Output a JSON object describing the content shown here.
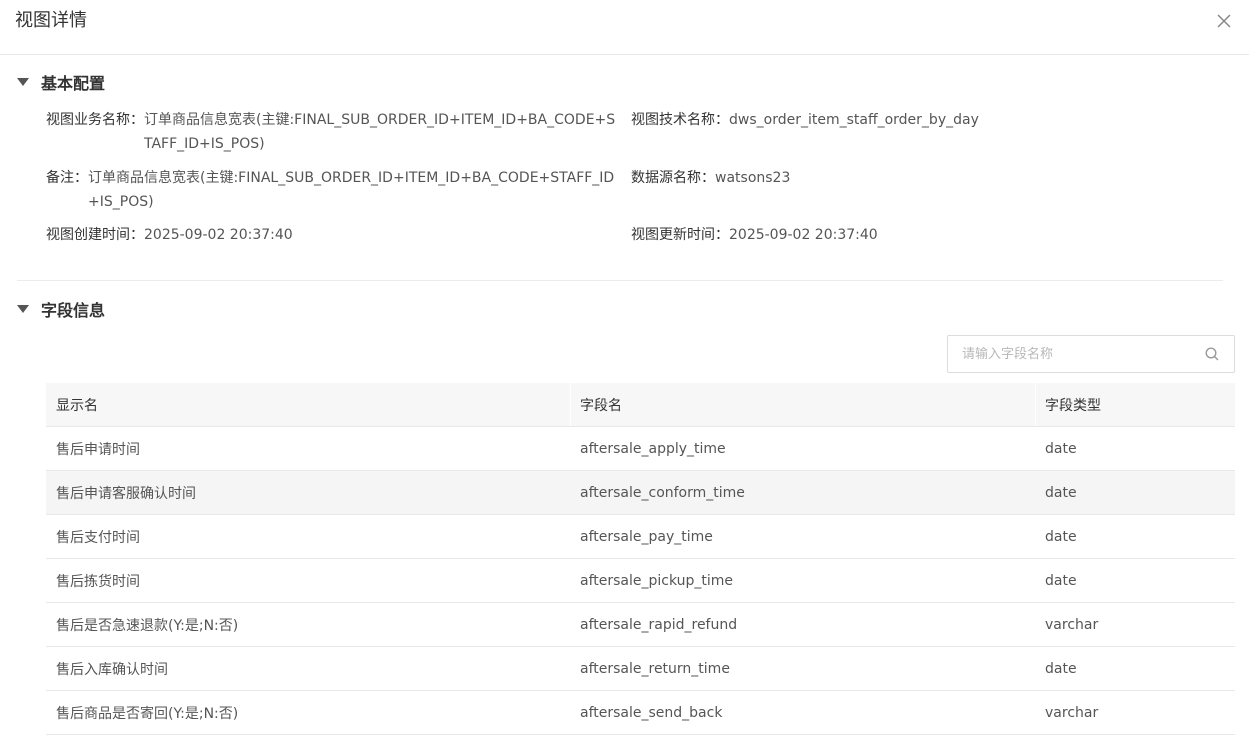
{
  "window": {
    "title": "视图详情",
    "close_icon": "close-icon"
  },
  "basic": {
    "section_title": "基本配置",
    "fields": {
      "biz_name": {
        "label": "视图业务名称：",
        "value": "订单商品信息宽表(主键:FINAL_SUB_ORDER_ID+ITEM_ID+BA_CODE+STAFF_ID+IS_POS)"
      },
      "tech_name": {
        "label": "视图技术名称：",
        "value": "dws_order_item_staff_order_by_day"
      },
      "remark": {
        "label": "备注：",
        "value": "订单商品信息宽表(主键:FINAL_SUB_ORDER_ID+ITEM_ID+BA_CODE+STAFF_ID+IS_POS)"
      },
      "datasource": {
        "label": "数据源名称：",
        "value": "watsons23"
      },
      "created": {
        "label": "视图创建时间：",
        "value": "2025-09-02 20:37:40"
      },
      "updated": {
        "label": "视图更新时间：",
        "value": "2025-09-02 20:37:40"
      }
    }
  },
  "fields_section": {
    "section_title": "字段信息",
    "search": {
      "placeholder": "请输入字段名称",
      "value": "",
      "icon": "search-icon"
    },
    "columns": [
      "显示名",
      "字段名",
      "字段类型"
    ],
    "rows": [
      [
        "售后申请时间",
        "aftersale_apply_time",
        "date"
      ],
      [
        "售后申请客服确认时间",
        "aftersale_conform_time",
        "date"
      ],
      [
        "售后支付时间",
        "aftersale_pay_time",
        "date"
      ],
      [
        "售后拣货时间",
        "aftersale_pickup_time",
        "date"
      ],
      [
        "售后是否急速退款(Y:是;N:否)",
        "aftersale_rapid_refund",
        "varchar"
      ],
      [
        "售后入库确认时间",
        "aftersale_return_time",
        "date"
      ],
      [
        "售后商品是否寄回(Y:是;N:否)",
        "aftersale_send_back",
        "varchar"
      ]
    ]
  }
}
